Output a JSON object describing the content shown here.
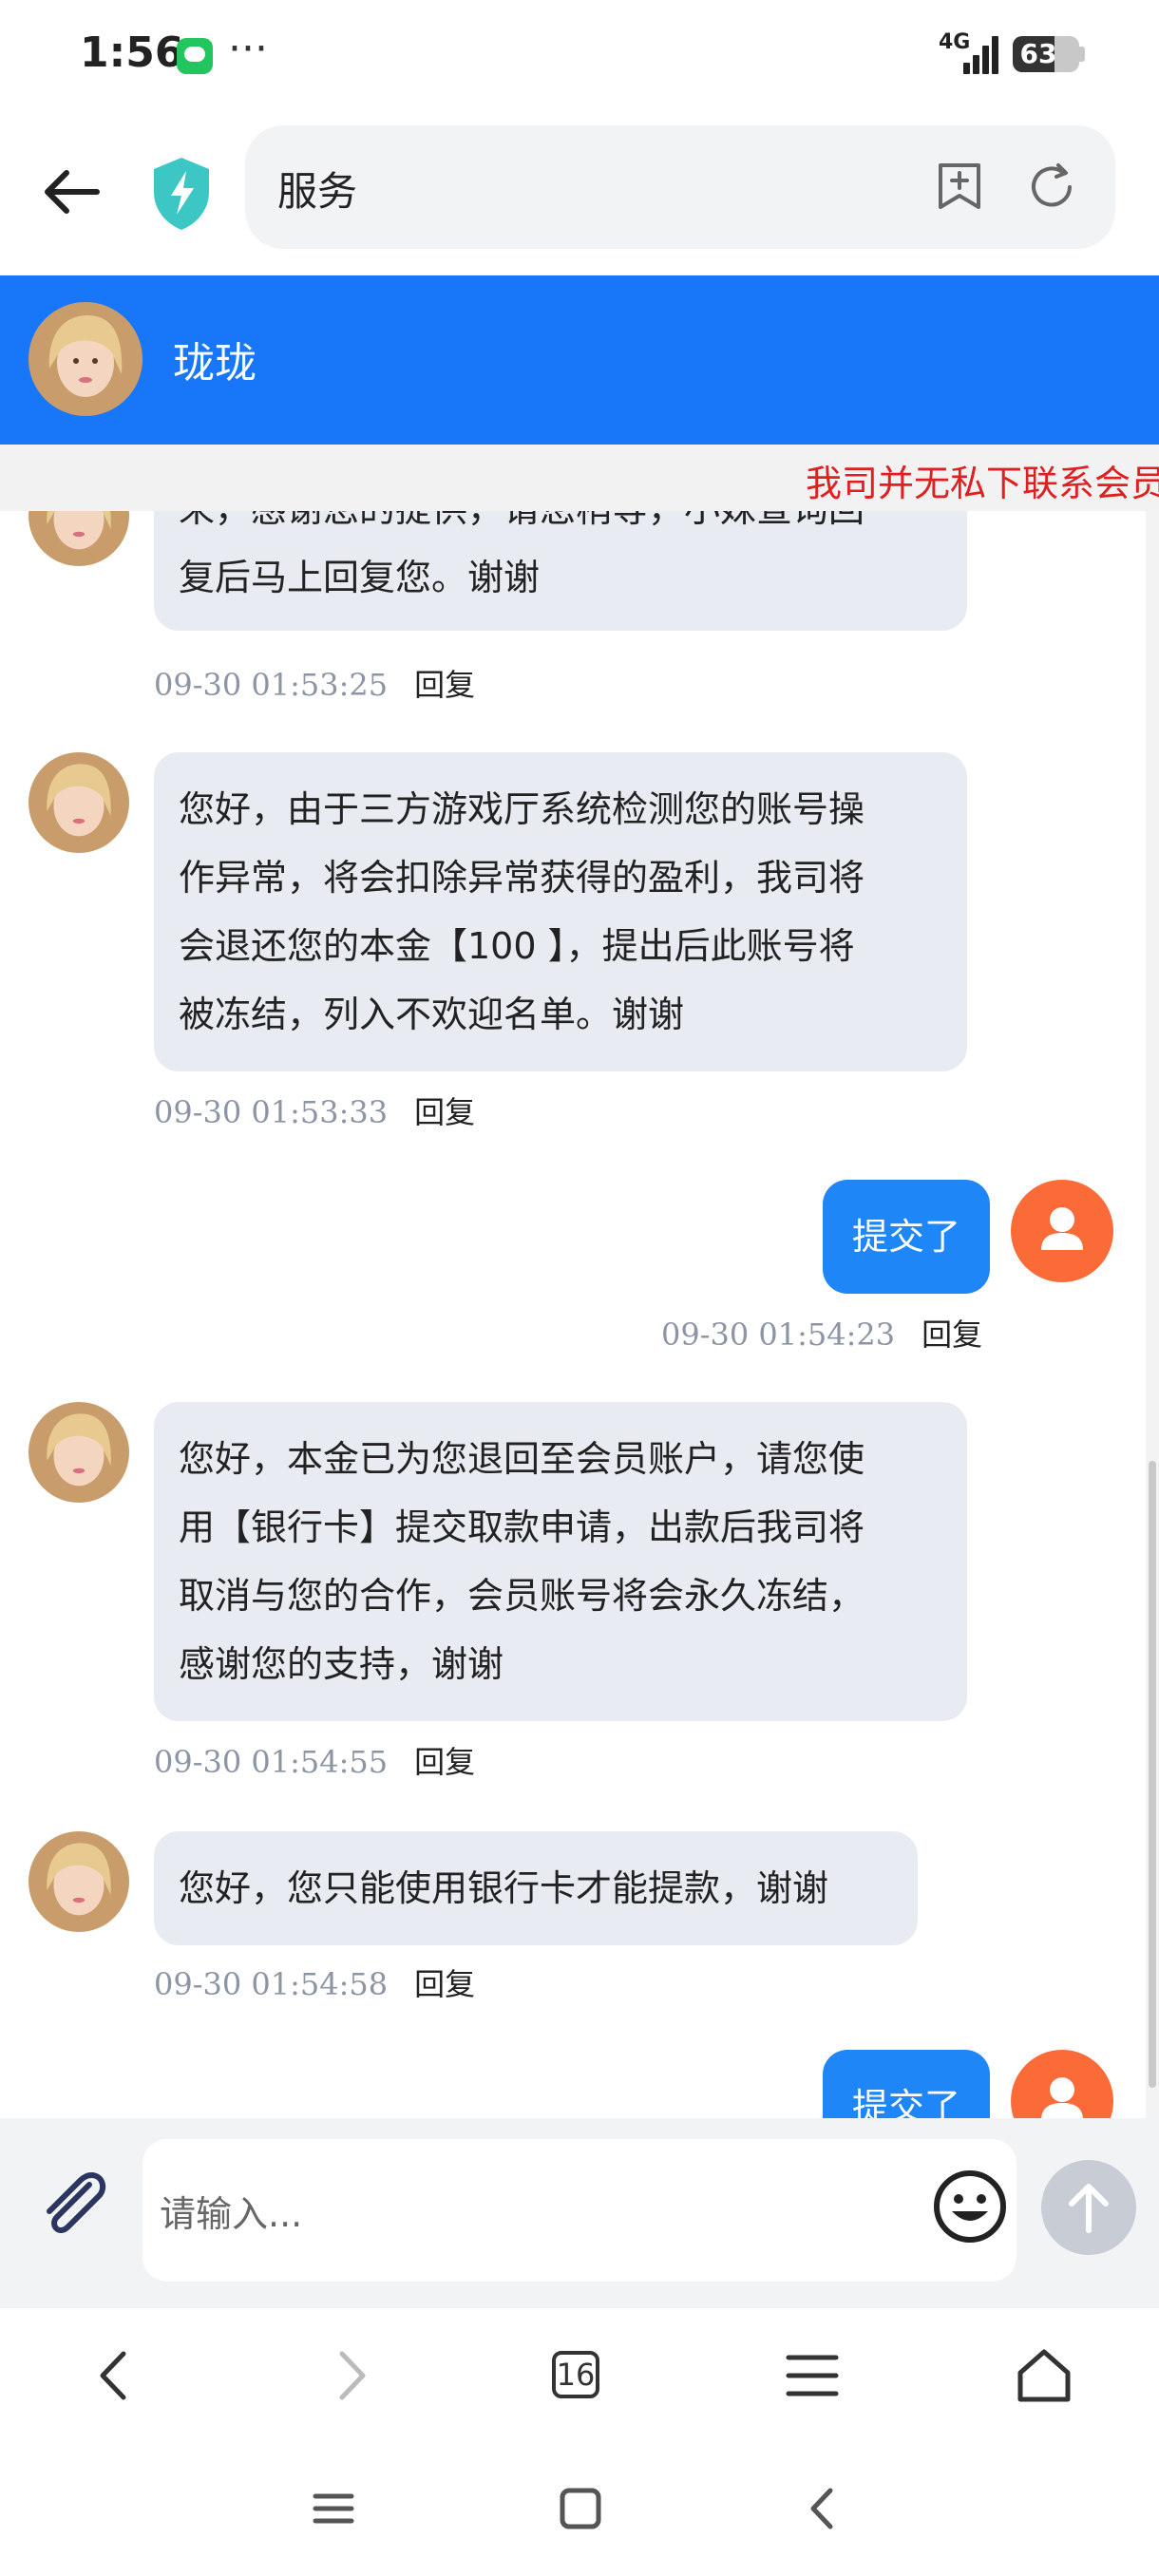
{
  "status_bar": {
    "time": "1:56",
    "more": "···",
    "network": "4G",
    "battery": "63",
    "battery_level": 0.63
  },
  "browser": {
    "url": "服务",
    "tab_count": "16"
  },
  "chat": {
    "agent_name": "珑珑",
    "notice": "我司并无私下联系会员",
    "messages": [
      {
        "from": "agent",
        "lines": [
          "来，感谢您的提供，请您稍等，小妹查询回",
          "复后马上回复您。谢谢"
        ],
        "time": "09-30 01:53:25",
        "reply": "回复"
      },
      {
        "from": "agent",
        "lines": [
          "您好，由于三方游戏厅系统检测您的账号操",
          "作异常，将会扣除异常获得的盈利，我司将",
          "会退还您的本金【100 】，提出后此账号将",
          "被冻结，列入不欢迎名单。谢谢"
        ],
        "time": "09-30 01:53:33",
        "reply": "回复"
      },
      {
        "from": "user",
        "text": "提交了",
        "time": "09-30 01:54:23",
        "reply": "回复"
      },
      {
        "from": "agent",
        "lines": [
          "您好，本金已为您退回至会员账户，请您使",
          "用【银行卡】提交取款申请，出款后我司将",
          "取消与您的合作，会员账号将会永久冻结，",
          "感谢您的支持，谢谢"
        ],
        "time": "09-30 01:54:55",
        "reply": "回复"
      },
      {
        "from": "agent",
        "lines": [
          "您好，您只能使用银行卡才能提款，谢谢"
        ],
        "time": "09-30 01:54:58",
        "reply": "回复"
      },
      {
        "from": "user",
        "text": "提交了"
      }
    ]
  },
  "input": {
    "placeholder": "请输入..."
  },
  "colors": {
    "header": "#1877f8",
    "user_bubble": "#1e86f7",
    "agent_bubble": "#e8ebf1",
    "notice": "#e02020",
    "user_avatar": "#fa6b38"
  },
  "icons": [
    "back-arrow-icon",
    "shield-bolt-icon",
    "bookmark-add-icon",
    "reload-icon",
    "paperclip-icon",
    "smiley-icon",
    "arrow-up-icon",
    "chevron-left-icon",
    "chevron-right-icon",
    "tabs-icon",
    "menu-icon",
    "home-icon"
  ]
}
